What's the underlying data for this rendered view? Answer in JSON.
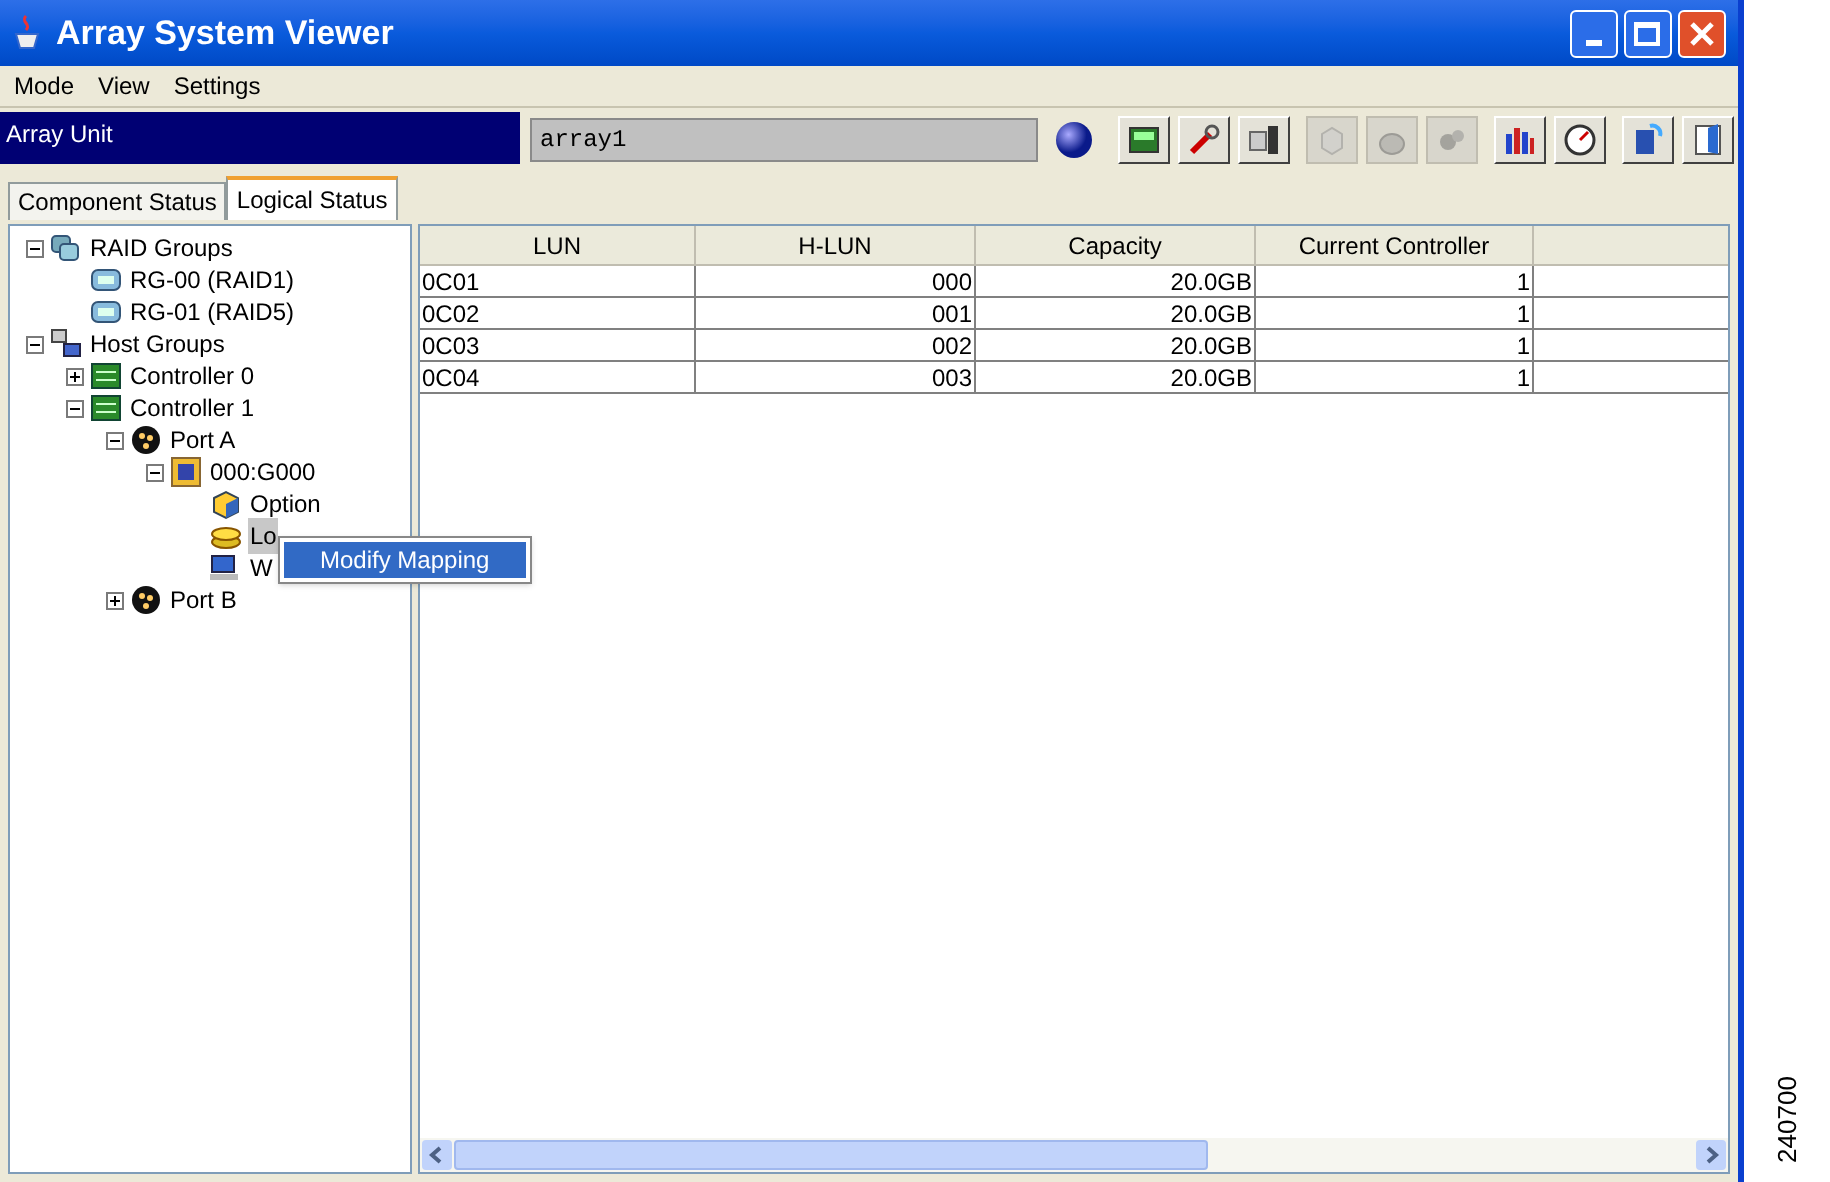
{
  "window": {
    "title": "Array System Viewer"
  },
  "menu": [
    "Mode",
    "View",
    "Settings"
  ],
  "unit_bar": {
    "label": "Array Unit",
    "value": "array1"
  },
  "toolbar": [
    {
      "kind": "monitor",
      "disabled": false
    },
    {
      "kind": "wrench",
      "disabled": false
    },
    {
      "kind": "panel",
      "disabled": false
    },
    {
      "kind": "cube",
      "disabled": true
    },
    {
      "kind": "disk",
      "disabled": true
    },
    {
      "kind": "gears",
      "disabled": true
    },
    {
      "kind": "chart",
      "disabled": false
    },
    {
      "kind": "gauge",
      "disabled": false
    },
    {
      "kind": "refresh",
      "disabled": false
    },
    {
      "kind": "exit",
      "disabled": false
    }
  ],
  "tabs": [
    {
      "label": "Component Status",
      "selected": false
    },
    {
      "label": "Logical Status",
      "selected": true
    }
  ],
  "tree": [
    {
      "label": "RAID Groups",
      "kind": "raid-groups",
      "expanded": true,
      "selected": false,
      "children": [
        {
          "label": "RG-00 (RAID1)",
          "kind": "raid",
          "selected": false
        },
        {
          "label": "RG-01 (RAID5)",
          "kind": "raid",
          "selected": false
        }
      ]
    },
    {
      "label": "Host Groups",
      "kind": "host-groups",
      "expanded": true,
      "selected": false,
      "children": [
        {
          "label": "Controller 0",
          "kind": "controller",
          "expanded": false,
          "selected": false
        },
        {
          "label": "Controller 1",
          "kind": "controller",
          "expanded": true,
          "selected": false,
          "children": [
            {
              "label": "Port A",
              "kind": "port",
              "expanded": true,
              "selected": false,
              "children": [
                {
                  "label": "000:G000",
                  "kind": "group",
                  "expanded": true,
                  "selected": false,
                  "children": [
                    {
                      "label": "Option",
                      "kind": "option",
                      "selected": false
                    },
                    {
                      "label": "Lo",
                      "kind": "lu",
                      "selected": true
                    },
                    {
                      "label": "W",
                      "kind": "wwn",
                      "selected": false
                    }
                  ]
                }
              ]
            },
            {
              "label": "Port B",
              "kind": "port",
              "expanded": false,
              "selected": false
            }
          ]
        }
      ]
    }
  ],
  "context_menu": [
    "Modify Mapping"
  ],
  "table": {
    "columns": [
      "LUN",
      "H-LUN",
      "Capacity",
      "Current Controller"
    ],
    "rows": [
      [
        "0C01",
        "000",
        "20.0GB",
        "1"
      ],
      [
        "0C02",
        "001",
        "20.0GB",
        "1"
      ],
      [
        "0C03",
        "002",
        "20.0GB",
        "1"
      ],
      [
        "0C04",
        "003",
        "20.0GB",
        "1"
      ]
    ]
  },
  "figure_number": "240700"
}
